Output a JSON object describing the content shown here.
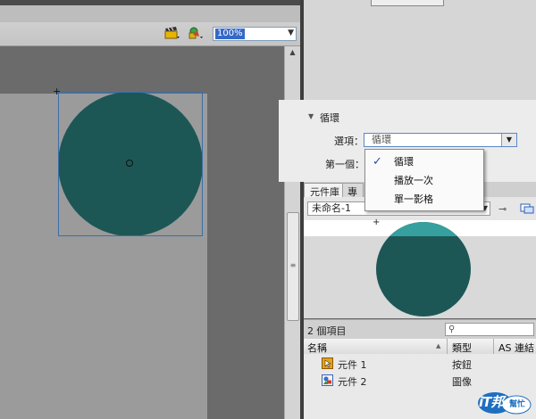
{
  "toolbar": {
    "zoom_value": "100%",
    "icons": [
      "clapper-icon",
      "symbol-icon"
    ]
  },
  "properties": {
    "section_title": "循環",
    "options_label": "選項：",
    "options_value": "循環",
    "first_frame_label": "第一個："
  },
  "loop_menu": {
    "items": [
      {
        "label": "循環",
        "checked": true
      },
      {
        "label": "播放一次",
        "checked": false
      },
      {
        "label": "單一影格",
        "checked": false
      }
    ]
  },
  "library": {
    "tab_library": "元件庫",
    "tab_other": "專",
    "document_select": "未命名-1",
    "item_count": "2 個項目",
    "columns": {
      "name": "名稱",
      "type": "類型",
      "linkage": "AS 連結"
    },
    "rows": [
      {
        "name": "元件 1",
        "type": "按鈕",
        "icon": "button-symbol-icon"
      },
      {
        "name": "元件 2",
        "type": "圖像",
        "icon": "graphic-symbol-icon"
      }
    ]
  },
  "logo": {
    "text": "iT邦",
    "sub": "幫忙"
  },
  "colors": {
    "circle_fill": "#1c5756",
    "selection": "#3569c8"
  }
}
